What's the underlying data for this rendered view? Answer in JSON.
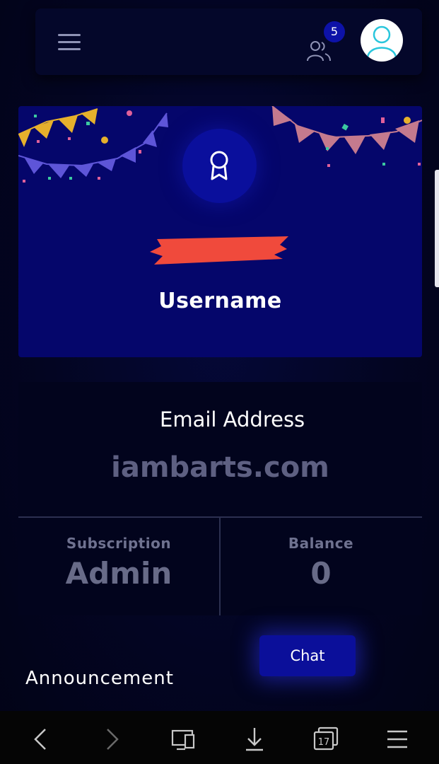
{
  "header": {
    "notification_count": "5",
    "menu_icon": "hamburger-icon",
    "users_icon": "users-icon",
    "avatar_icon": "user-avatar-icon"
  },
  "banner": {
    "award_icon": "award-ribbon-icon",
    "username": "Username",
    "background_color": "#05066b"
  },
  "profile": {
    "email_label": "Email Address",
    "email_value": "iambarts.com",
    "subscription_label": "Subscription",
    "subscription_value": "Admin",
    "balance_label": "Balance",
    "balance_value": "0"
  },
  "chat_button": {
    "label": "Chat"
  },
  "announcement": {
    "heading": "Announcement"
  },
  "browser_toolbar": {
    "tabs_count": "17",
    "icons": [
      "back-arrow-icon",
      "forward-arrow-icon",
      "desktop-view-icon",
      "download-icon",
      "tabs-icon",
      "menu-icon"
    ]
  },
  "colors": {
    "accent": "#0b0f9a",
    "page_background": "#020418",
    "redaction": "#f04a3c"
  }
}
